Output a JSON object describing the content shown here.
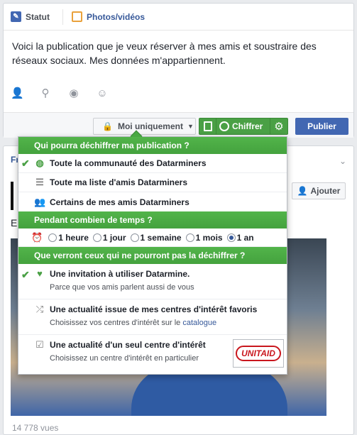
{
  "composer": {
    "tabs": [
      {
        "label": "Statut",
        "icon": "pencil-icon",
        "active": true
      },
      {
        "label": "Photos/vidéos",
        "icon": "photo-icon",
        "active": false
      }
    ],
    "status_text": "Voici la publication que je veux réserver à mes amis et soustraire des réseaux sociaux. Mes données m'appartiennent.",
    "icons": [
      "tag-friends-icon",
      "location-icon",
      "camera-icon",
      "emoji-icon"
    ],
    "privacy_label": "Moi uniquement",
    "datarmine_label": "Chiffrer",
    "publish_label": "Publier"
  },
  "feed": {
    "label_partial": "Fr",
    "text_partial": "E",
    "ajouter_label": "Ajouter",
    "views": "14 778 vues"
  },
  "menu": {
    "section1_title": "Qui pourra déchiffrer ma publication ?",
    "audience_options": [
      {
        "label": "Toute la communauté des Datarminers",
        "icon": "globe-icon",
        "checked": true
      },
      {
        "label": "Toute ma liste d'amis Datarminers",
        "icon": "list-icon",
        "checked": false
      },
      {
        "label": "Certains de mes amis Datarminers",
        "icon": "people-icon",
        "checked": false
      }
    ],
    "section2_title": "Pendant combien de temps ?",
    "durations": [
      {
        "label": "1 heure",
        "selected": false
      },
      {
        "label": "1 jour",
        "selected": false
      },
      {
        "label": "1 semaine",
        "selected": false
      },
      {
        "label": "1 mois",
        "selected": false
      },
      {
        "label": "1 an",
        "selected": true
      }
    ],
    "section3_title": "Que verront ceux qui ne pourront pas la déchiffrer ?",
    "fallback_options": [
      {
        "title": "Une invitation à utiliser Datarmine.",
        "sub": "Parce que vos amis parlent aussi de vous",
        "icon": "heart-icon",
        "checked": true
      },
      {
        "title": "Une actualité issue de mes centres d'intérêt favoris",
        "sub": "Choisissez vos centres d'intérêt sur le",
        "link": "catalogue",
        "icon": "shuffle-icon",
        "checked": false
      },
      {
        "title": "Une actualité d'un seul centre d'intérêt",
        "sub": "Choisissez un centre d'intérêt en particulier",
        "icon": "checkbox-icon",
        "checked": false,
        "logo": "UNITAID"
      }
    ]
  },
  "colors": {
    "green": "#4aa045",
    "fb_blue": "#4267b2",
    "link": "#365899"
  }
}
